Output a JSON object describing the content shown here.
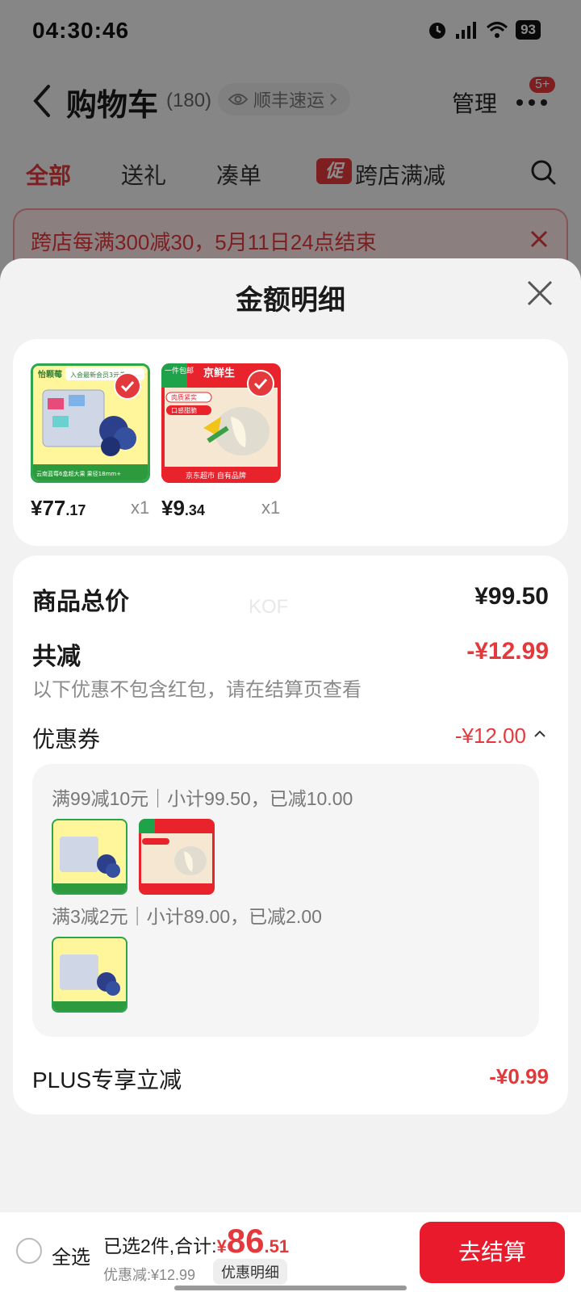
{
  "status_bar": {
    "time": "04:30:46",
    "network": "4G+",
    "battery": "93"
  },
  "cart_header": {
    "title": "购物车",
    "count": "(180)",
    "shipping_pill": "顺丰速运",
    "manage_label": "管理",
    "badge": "5+"
  },
  "cart_tabs": [
    {
      "label": "全部",
      "active": true
    },
    {
      "label": "送礼",
      "active": false
    },
    {
      "label": "凑单",
      "active": false
    },
    {
      "label": "跨店满减",
      "active": false,
      "tag": "促"
    }
  ],
  "promo_banner": {
    "text": "跨店每满300减30，5月11日24点结束"
  },
  "sheet": {
    "title": "金额明细",
    "products": [
      {
        "name": "blueberry-box",
        "price_int": "¥77",
        "price_dec": ".17",
        "qty": "x1"
      },
      {
        "name": "jingxiansheng-item",
        "price_int": "¥9",
        "price_dec": ".34",
        "qty": "x1"
      }
    ],
    "thumb_text": {
      "blueberry_brand": "怡颗莓",
      "blueberry_banner": "入会最新会员3元券",
      "blueberry_footer": "云南蓝莓6盒超大果 果径18mm+",
      "jx_corner": "一件包邮",
      "jx_brand": "京鲜生",
      "jx_tag1": "肉质紧实",
      "jx_tag2": "口感甜脆",
      "jx_footer": "京东超市 自有品牌"
    },
    "watermark": "KOF",
    "total_label": "商品总价",
    "total_value": "¥99.50",
    "reduce_label": "共减",
    "reduce_value": "-¥12.99",
    "reduce_note": "以下优惠不包含红包，请在结算页查看",
    "coupon_label": "优惠券",
    "coupon_value": "-¥12.00",
    "coupon_rules": [
      "满99减10元｜小计99.50，已减10.00",
      "满3减2元｜小计89.00，已减2.00"
    ],
    "plus_label": "PLUS专享立减",
    "plus_value": "-¥0.99"
  },
  "bottom_bar": {
    "select_all": "全选",
    "summary_prefix": "已选2件,合计:",
    "total_yen": "¥",
    "total_int": "86",
    "total_dec": ".51",
    "discount": "优惠减:¥12.99",
    "detail_pill": "优惠明细",
    "checkout": "去结算"
  },
  "colors": {
    "accent": "#e4393c",
    "checkout": "#e91a2c",
    "sheet_bg": "#f2f2f2"
  }
}
